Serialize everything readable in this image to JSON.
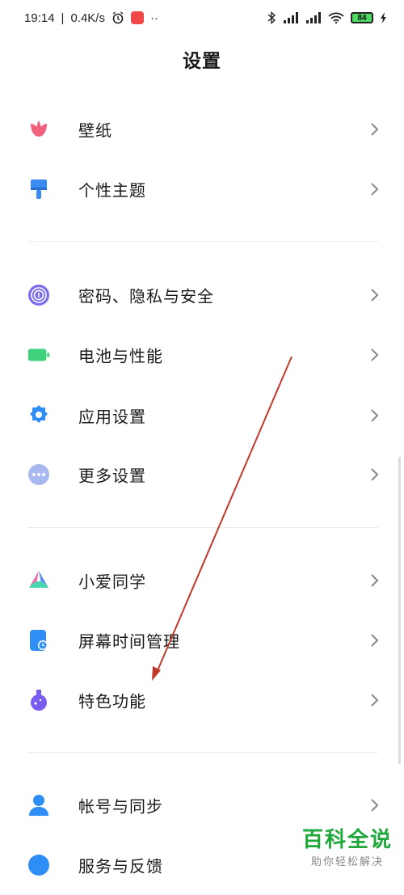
{
  "status_bar": {
    "time": "19:14",
    "speed": "0.4K/s",
    "battery": "84"
  },
  "header": {
    "title": "设置"
  },
  "groups": [
    {
      "items": [
        {
          "label": "壁纸",
          "icon": "tulip-icon"
        },
        {
          "label": "个性主题",
          "icon": "paintbrush-icon"
        }
      ]
    },
    {
      "items": [
        {
          "label": "密码、隐私与安全",
          "icon": "fingerprint-icon"
        },
        {
          "label": "电池与性能",
          "icon": "battery-icon"
        },
        {
          "label": "应用设置",
          "icon": "gear-icon"
        },
        {
          "label": "更多设置",
          "icon": "more-dots-icon"
        }
      ]
    },
    {
      "items": [
        {
          "label": "小爱同学",
          "icon": "xiaoai-icon"
        },
        {
          "label": "屏幕时间管理",
          "icon": "screen-time-icon"
        },
        {
          "label": "特色功能",
          "icon": "flask-icon"
        }
      ]
    },
    {
      "items": [
        {
          "label": "帐号与同步",
          "icon": "person-icon"
        },
        {
          "label": "服务与反馈",
          "icon": "service-icon"
        }
      ]
    }
  ],
  "watermark": {
    "main": "百科全说",
    "sub": "助你轻松解决"
  },
  "colors": {
    "tulip": "#f0627e",
    "brush": "#3b8cf0",
    "fingerprint": "#7b6cf0",
    "battery": "#3ed17a",
    "gear": "#2f8ef5",
    "more": "#a8b8f0",
    "flask": "#7a5cf0",
    "person": "#2f8ef5",
    "annotation_arrow": "#c0392b"
  }
}
